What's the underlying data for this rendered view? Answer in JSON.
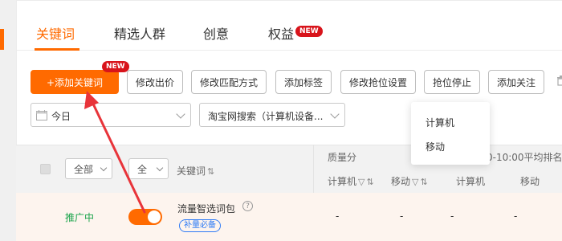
{
  "tabs": [
    {
      "label": "关键词"
    },
    {
      "label": "精选人群"
    },
    {
      "label": "创意"
    },
    {
      "label": "权益",
      "badge": "NEW"
    }
  ],
  "toolbar": {
    "add_keyword": "+添加关键词",
    "add_keyword_badge": "NEW",
    "buttons": [
      "修改出价",
      "修改匹配方式",
      "添加标签",
      "修改抢位设置",
      "抢位停止",
      "添加关注"
    ]
  },
  "filters": {
    "date_value": "今日",
    "channel_value": "淘宝网搜索（计算机设备..."
  },
  "popup": {
    "items": [
      "计算机",
      "移动"
    ]
  },
  "table_header": {
    "status_select": "全部",
    "type_select": "全",
    "keyword_col": "关键词",
    "quality_group": "质量分",
    "rank_group_partial": "0-10:00平均排名",
    "sub_cols": [
      "计算机",
      "移动",
      "计算机",
      "移动"
    ]
  },
  "rows": [
    {
      "status": "推广中",
      "toggle_on": true,
      "keyword": "流量智选词包",
      "tag": "补量必备",
      "cells": [
        "-",
        "-",
        "-",
        "-"
      ]
    }
  ],
  "colors": {
    "accent": "#ff6a00",
    "badge": "#d8141b",
    "status_green": "#19a34a",
    "tag_blue": "#2f7bf5",
    "arrow": "#e8343a"
  },
  "icons": {
    "calendar": "calendar-icon",
    "help": "help-circle-icon",
    "trash": "trash-icon",
    "sort": "sort-icon",
    "filter": "filter-icon"
  }
}
